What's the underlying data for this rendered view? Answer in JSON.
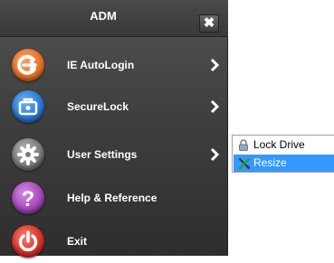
{
  "window": {
    "title": "ADM",
    "close_label": "✖"
  },
  "menu": {
    "items": [
      {
        "label": "IE AutoLogin",
        "icon": "ie-autologin-icon",
        "color": "#e8742a",
        "has_submenu": true
      },
      {
        "label": "SecureLock",
        "icon": "securelock-icon",
        "color": "#2a7ad6",
        "has_submenu": true
      },
      {
        "label": "User Settings",
        "icon": "gear-icon",
        "color": "#7a7a7a",
        "has_submenu": true
      },
      {
        "label": "Help & Reference",
        "icon": "help-icon",
        "color": "#a44bb8",
        "has_submenu": false
      },
      {
        "label": "Exit",
        "icon": "power-icon",
        "color": "#d9332a",
        "has_submenu": false
      }
    ]
  },
  "submenu": {
    "items": [
      {
        "label": "Lock Drive",
        "icon": "lock-icon",
        "selected": false
      },
      {
        "label": "Resize",
        "icon": "resize-tools-icon",
        "selected": true
      }
    ],
    "selected_color": "#3399ff"
  }
}
